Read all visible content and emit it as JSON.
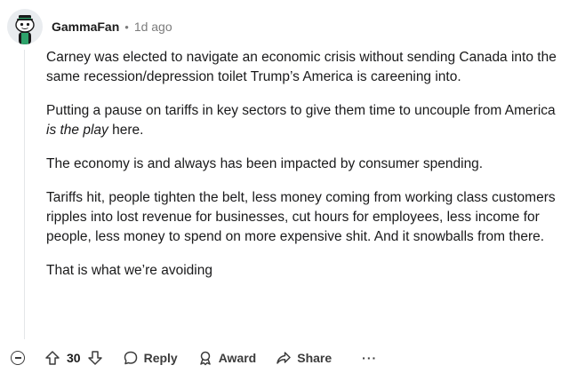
{
  "comment": {
    "author": "GammaFan",
    "separator": "•",
    "timestamp": "1d ago",
    "paragraphs": [
      {
        "text": "Carney was elected to navigate an economic crisis without sending Canada into the same recession/depression toilet Trump’s America is careening into."
      },
      {
        "before": "Putting a pause on tariffs in key sectors to give them time to uncouple from America ",
        "emphasis": "is the play",
        "after": " here."
      },
      {
        "text": "The economy is and always has been impacted by consumer spending."
      },
      {
        "text": "Tariffs hit, people tighten the belt, less money coming from working class customers ripples into lost revenue for businesses, cut hours for employees, less income for people, less money to spend on more expensive shit. And it snowballs from there."
      },
      {
        "text": "That is what we’re avoiding"
      }
    ]
  },
  "actions": {
    "vote_count": "30",
    "reply_label": "Reply",
    "award_label": "Award",
    "share_label": "Share",
    "more_label": "···"
  },
  "icons": {
    "collapse": "collapse-icon",
    "upvote": "upvote-icon",
    "downvote": "downvote-icon",
    "reply": "reply-icon",
    "award": "award-icon",
    "share": "share-icon",
    "more": "more-icon"
  },
  "colors": {
    "avatar_body": "#1a1a1b",
    "avatar_accent": "#2ea36b",
    "muted_text": "#7c7c7c"
  }
}
